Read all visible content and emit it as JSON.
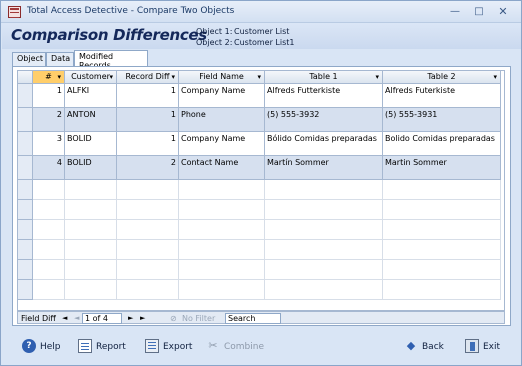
{
  "window": {
    "title": "Total Access Detective - Compare Two Objects",
    "minimize_glyph": "—",
    "maximize_glyph": "□",
    "close_glyph": "✕"
  },
  "header": {
    "title": "Comparison Differences",
    "object1_label": "Object 1:",
    "object1_value": "Customer List",
    "object2_label": "Object 2:",
    "object2_value": "Customer List1"
  },
  "tabs": [
    {
      "label": "Object",
      "active": false
    },
    {
      "label": "Data",
      "active": false
    },
    {
      "label": "Modified Records",
      "active": true
    }
  ],
  "grid": {
    "columns": [
      "#",
      "Customer",
      "Record Diff",
      "Field Name",
      "Table 1",
      "Table 2"
    ],
    "rows": [
      {
        "num": "1",
        "customer": "ALFKI",
        "record_diff": "1",
        "field_name": "Company Name",
        "table1": "Alfreds Futterkiste",
        "table2": "Alfreds Futerkiste"
      },
      {
        "num": "2",
        "customer": "ANTON",
        "record_diff": "1",
        "field_name": "Phone",
        "table1": "(5) 555-3932",
        "table2": "(5) 555-3931"
      },
      {
        "num": "3",
        "customer": "BOLID",
        "record_diff": "1",
        "field_name": "Company Name",
        "table1": "Bólido Comidas preparadas",
        "table2": "Bolido Comidas preparadas"
      },
      {
        "num": "4",
        "customer": "BOLID",
        "record_diff": "2",
        "field_name": "Contact Name",
        "table1": "Martín Sommer",
        "table2": "Martin Sommer"
      }
    ]
  },
  "navbar": {
    "field_label": "Field Diff",
    "first_glyph": "◄",
    "prev_glyph": "◄",
    "record": "1 of 4",
    "next_glyph": "►",
    "last_glyph": "►",
    "filter": "No Filter",
    "search": "Search"
  },
  "toolbar": {
    "help": "Help",
    "report": "Report",
    "export": "Export",
    "combine": "Combine",
    "back": "Back",
    "exit": "Exit"
  },
  "colors": {
    "header_title": "#14285a",
    "row_shaded": "#d6e0ef",
    "selected_header": "#ffce6a"
  }
}
